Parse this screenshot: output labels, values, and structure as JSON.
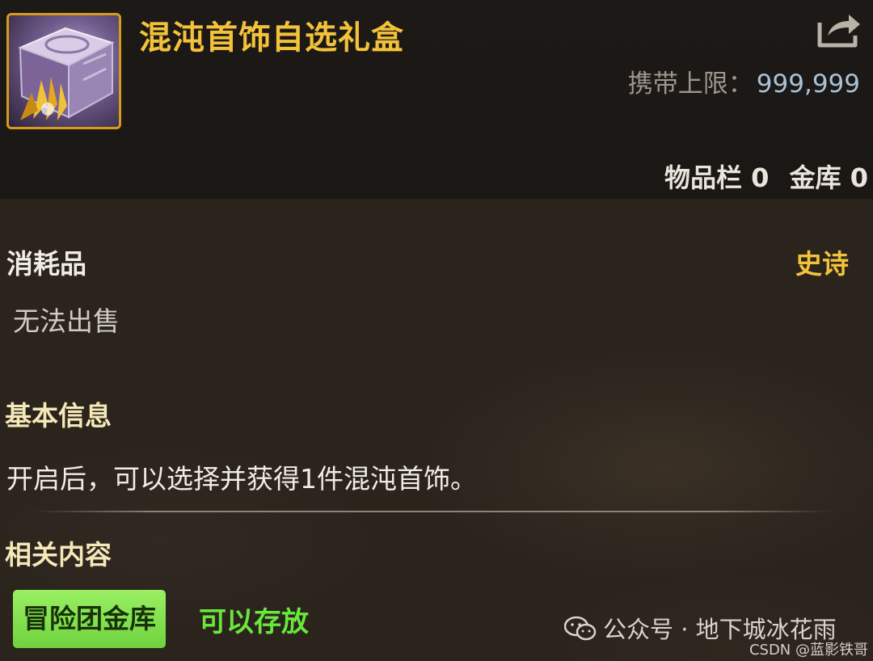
{
  "item": {
    "title": "混沌首饰自选礼盒",
    "icon": "chaos-gift-box-icon",
    "carry_limit_label": "携带上限：",
    "carry_limit_value": "999,999",
    "inventory_label": "物品栏 0",
    "vault_label": "金库 0"
  },
  "info": {
    "type": "消耗品",
    "rarity": "史诗",
    "sell_status": "无法出售",
    "basic_info_heading": "基本信息",
    "description": "开启后，可以选择并获得1件混沌首饰。",
    "related_heading": "相关内容",
    "storage_tag": "冒险团金库",
    "storage_status": "可以存放"
  },
  "watermark": {
    "text": "公众号 · 地下城冰花雨",
    "credit": "CSDN @蓝影铁哥"
  },
  "colors": {
    "title": "#f3c23a",
    "rarity_epic": "#f3c23a",
    "storage_tag_bg": "#7ed84a",
    "storage_status": "#69e83c",
    "carry_value": "#a9c1d6"
  }
}
